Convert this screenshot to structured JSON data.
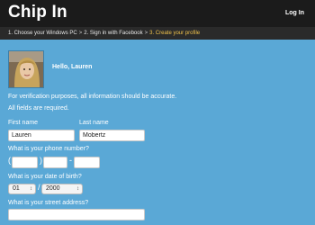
{
  "header": {
    "title": "Chip In",
    "login_label": "Log In"
  },
  "steps": [
    {
      "label": "1. Choose your Windows PC"
    },
    {
      "label": "2. Sign in with Facebook"
    },
    {
      "label": "3. Create your profile"
    }
  ],
  "steps_separator": ">",
  "user": {
    "greeting": "Hello, Lauren"
  },
  "form": {
    "intro": "For verification purposes, all information should be accurate.",
    "required_note": "All fields are required.",
    "first_name_label": "First name",
    "first_name_value": "Lauren",
    "last_name_label": "Last name",
    "last_name_value": "Mobertz",
    "phone_label": "What is your phone number?",
    "phone_open_paren": "(",
    "phone_close_paren": ")",
    "phone_dash": "-",
    "phone_area": "",
    "phone_prefix": "",
    "phone_line": "",
    "dob_label": "What is your date of birth?",
    "dob_month": "01",
    "dob_slash": "/",
    "dob_year": "2000",
    "address_label": "What is your street address?",
    "address_value": ""
  },
  "colors": {
    "background": "#5aa8d6",
    "topbar": "#1b1b1b",
    "active_step": "#f0c24b"
  }
}
